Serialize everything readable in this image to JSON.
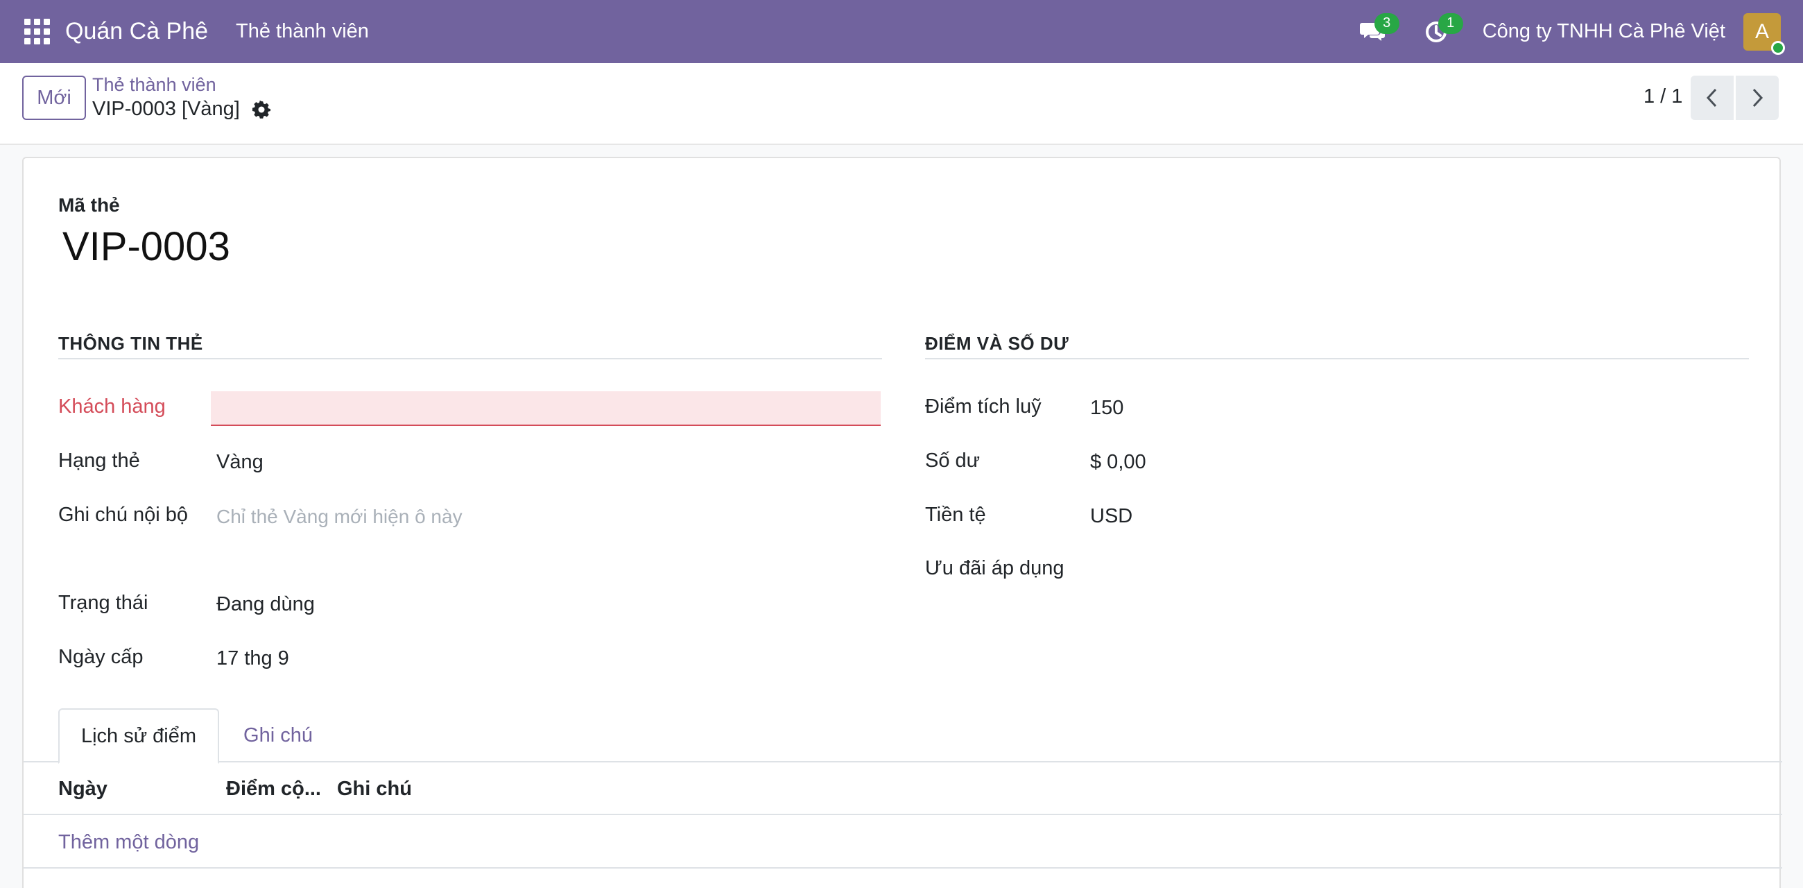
{
  "navbar": {
    "app_name": "Quán Cà Phê",
    "menu_item": "Thẻ thành viên",
    "messages_count": "3",
    "activities_count": "1",
    "company": "Công ty TNHH Cà Phê Việt",
    "avatar_initial": "A"
  },
  "control_panel": {
    "new_button": "Mới",
    "breadcrumb_parent": "Thẻ thành viên",
    "breadcrumb_current": "VIP-0003 [Vàng]",
    "pager_value": "1 / 1"
  },
  "form": {
    "code_label": "Mã thẻ",
    "code_value": "VIP-0003",
    "left_group": {
      "title": "THÔNG TIN THẺ",
      "customer_label": "Khách hàng",
      "customer_value": "",
      "tier_label": "Hạng thẻ",
      "tier_value": "Vàng",
      "note_label": "Ghi chú nội bộ",
      "note_placeholder": "Chỉ thẻ Vàng mới hiện ô này",
      "status_label": "Trạng thái",
      "status_value": "Đang dùng",
      "issue_date_label": "Ngày cấp",
      "issue_date_value": "17 thg 9"
    },
    "right_group": {
      "title": "ĐIỂM VÀ SỐ DƯ",
      "points_label": "Điểm tích luỹ",
      "points_value": "150",
      "balance_label": "Số dư",
      "balance_value": "$ 0,00",
      "currency_label": "Tiền tệ",
      "currency_value": "USD",
      "offers_label": "Ưu đãi áp dụng"
    },
    "tabs": [
      "Lịch sử điểm",
      "Ghi chú"
    ],
    "table": {
      "columns": [
        "Ngày",
        "Điểm cộ...",
        "Ghi chú"
      ],
      "add_line": "Thêm một dòng"
    }
  },
  "colors": {
    "brand": "#71639e",
    "invalid": "#d44c59",
    "badge": "#28a745"
  }
}
